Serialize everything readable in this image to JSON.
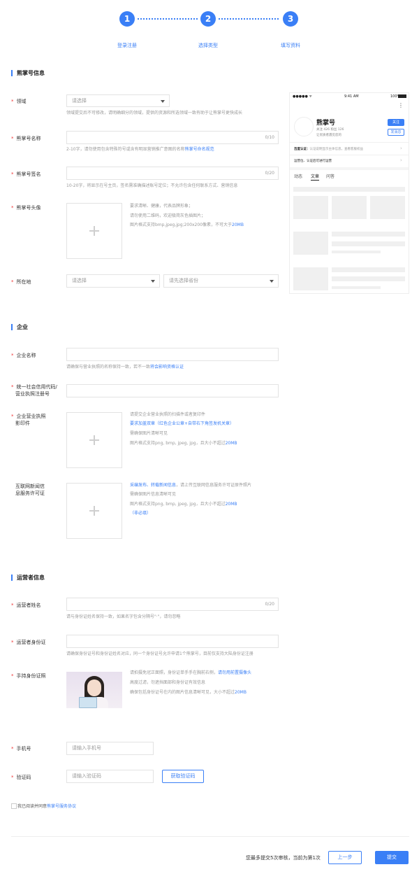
{
  "steps": [
    {
      "num": "1",
      "label": "登录注册"
    },
    {
      "num": "2",
      "label": "选择类型"
    },
    {
      "num": "3",
      "label": "填写资料"
    }
  ],
  "section1": {
    "title": "熊掌号信息",
    "domain_label": "领域",
    "domain_placeholder": "请选择",
    "domain_hint": "领域提交后不可修改，请明确细分的领域，提供的资源和所选领域一致有助于让熊掌号更快成长",
    "name_label": "熊掌号名称",
    "name_counter": "0/10",
    "name_hint": "2-10字，请勿使用包含特殊符号或含有明显营销推广意图的名称",
    "name_link": "熊掌号命名规范",
    "sig_label": "熊掌号签名",
    "sig_counter": "0/20",
    "sig_hint": "10-20字，将显示在号主页，签名需准确描述账号定位；不允许包含任何联系方式、营销信息",
    "avatar_label": "熊掌号头像",
    "avatar_hint1": "要求清晰、健康，代表品牌形象；",
    "avatar_hint2": "请勿使用二维码，欢迎极简灰色插图片；",
    "avatar_hint3_prefix": "图片格式支持bmp,jpeg,jpg;200x200像素，不可大于",
    "avatar_hint3_link": "20MB",
    "location_label": "所在地",
    "location_placeholder1": "请选择",
    "location_placeholder2": "请先选择省份"
  },
  "preview": {
    "status_left": "●●●●● ᯤ",
    "status_time": "9:41 AM",
    "status_right": "100%",
    "more": "⋮",
    "name": "熊掌号",
    "stats": "关注 426   粉丝 126",
    "desc": "让优质者遇见您的",
    "follow_btn": "关注",
    "msg_btn": "发消息",
    "row1_label": "百度认证：",
    "row1_text": "认证说明显示主体信息，查看客服权益",
    "row2_label": "运营位、认证后可进行运营",
    "tabs": [
      "动态",
      "文章",
      "问答"
    ]
  },
  "section2": {
    "title": "企业",
    "company_label": "企业名称",
    "company_hint_prefix": "请确保与营业执照的名称保持一致，若不一致",
    "company_hint_link": "将会影响资格认证",
    "credit_label_1": "统一社会信用代码/",
    "credit_label_2": "营业执照注册号",
    "license_label_1": "企业营业执照",
    "license_label_2": "影印件",
    "license_hint1": "请提交企业营业执照的扫描件或者复印件",
    "license_hint2": "要求加盖双章（红色企业公章+自带右下角签发机关章）",
    "license_hint3": "需确保图片清晰可见",
    "license_hint4_prefix": "图片格式支持png, bmp, jpeg, jpg，且大小不超过",
    "license_hint4_link": "20MB",
    "news_label_1": "互联网新闻信",
    "news_label_2": "息服务许可证",
    "news_hint1_link": "采编发布、转载新闻信息",
    "news_hint1_rest": "，请上传互联网信息服务许可证原件照片",
    "news_hint2": "需确保图片信息清晰可见",
    "news_hint3_prefix": "图片格式支持png, bmp, jpeg, jpg，且大小不超过",
    "news_hint3_link": "20MB",
    "news_hint4": "（非必填）"
  },
  "section3": {
    "title": "运营者信息",
    "op_name_label": "运营者姓名",
    "op_name_counter": "0/20",
    "op_name_hint": "请与身份证姓名保持一致，如果名字包含分隔号\"·\"，请勿忽略",
    "op_id_label": "运营者身份证",
    "op_id_hint": "请确保身份证号和身份证姓名对应，同一个身份证号允许申请1个熊掌号，目前仅支持大陆身份证注册",
    "hold_label": "手持身份证照",
    "hold_hint1_prefix": "请拍摄免冠正面照，身份证单手手在胸前右侧，",
    "hold_hint1_link": "请勿用前置摄像头",
    "hold_hint2": "高度过滤，勿遮挡面部和身份证有效信息",
    "hold_hint3_prefix": "确保包括身份证号在内的图片信息清晰可见，大小不超过",
    "hold_hint3_link": "20MB",
    "phone_label": "手机号",
    "phone_placeholder": "请输入手机号",
    "code_label": "验证码",
    "code_placeholder": "请输入验证码",
    "code_btn": "获取验证码",
    "agree_prefix": "我已阅读并同意",
    "agree_link": "熊掌号服务协议"
  },
  "footer": {
    "notice": "您最多提交5次审核，当前为第1次",
    "prev_btn": "上一步",
    "submit_btn": "提交"
  },
  "colors": {
    "accent": "#3a7ff6",
    "required": "#e33333"
  }
}
